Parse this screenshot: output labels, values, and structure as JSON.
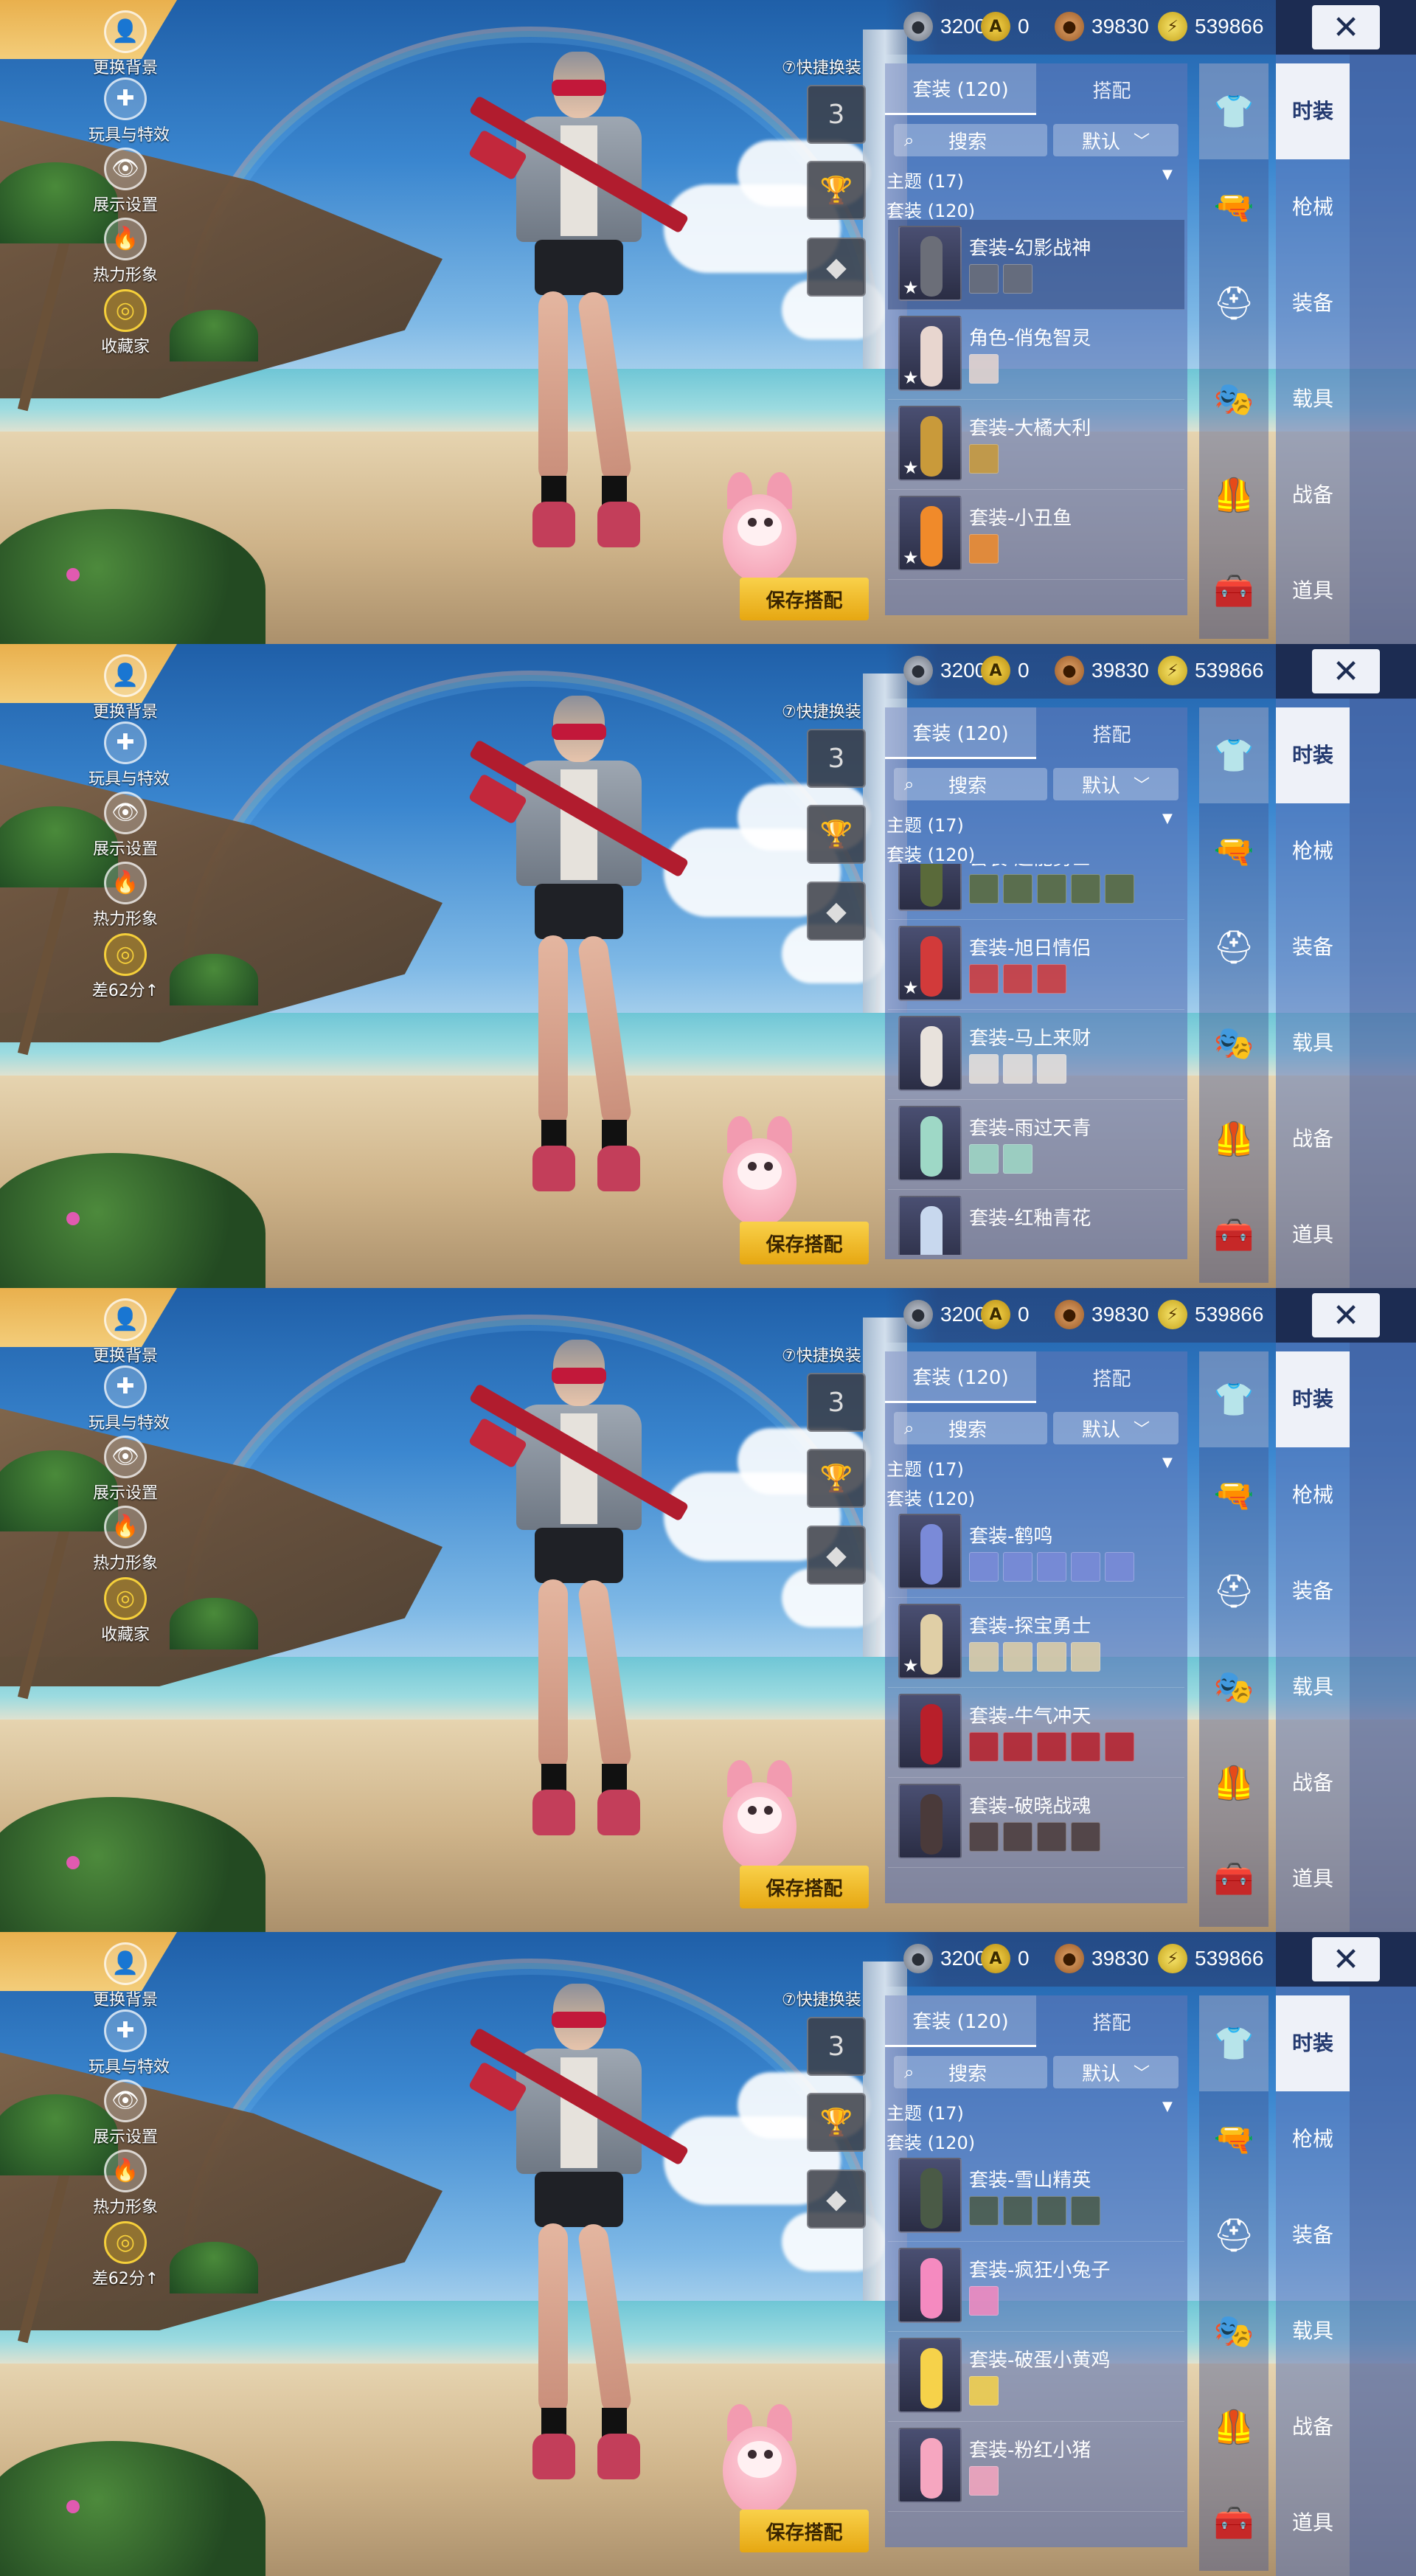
{
  "left_menu": [
    {
      "label": "更换背景",
      "icon": "person-icon",
      "glyph": "👤"
    },
    {
      "label": "玩具与特效",
      "icon": "puzzle-icon",
      "glyph": "✚"
    },
    {
      "label": "展示设置",
      "icon": "eye-icon",
      "glyph": "👁"
    },
    {
      "label": "热力形象",
      "icon": "flame-icon",
      "glyph": "🔥"
    }
  ],
  "collector_labels": [
    "收藏家",
    "差62分↑",
    "收藏家",
    "差62分↑"
  ],
  "currency": [
    {
      "icon": "silver-coin-icon",
      "glyph": "●",
      "value": "3200",
      "style": "grey"
    },
    {
      "icon": "gold-a-coin-icon",
      "glyph": "A",
      "value": "0",
      "style": "yellow"
    },
    {
      "icon": "bronze-coin-icon",
      "glyph": "●",
      "value": "39830",
      "style": "bronze"
    },
    {
      "icon": "lightning-coin-icon",
      "glyph": "⚡",
      "value": "539866",
      "style": "lightning"
    }
  ],
  "close_label": "✕",
  "quick_change": "⑦快捷换装",
  "quick_slots": [
    "3",
    "🏆",
    "◆"
  ],
  "save_label": "保存搭配",
  "tabs": [
    "套装 (120)",
    "搭配"
  ],
  "search_label": "搜索",
  "sort_label": "默认",
  "theme_label": "主题 (17)",
  "suits_label": "套装 (120)",
  "categories": [
    "时装",
    "枪械",
    "装备",
    "载具",
    "战备",
    "道具"
  ],
  "category_icons": [
    "clothing-icon",
    "gun-icon",
    "helmet-icon",
    "mask-icon",
    "vest-icon",
    "tools-icon"
  ],
  "category_glyphs": [
    "👕",
    "🔫",
    "⛑",
    "🎭",
    "🦺",
    "🧰"
  ],
  "frames": [
    {
      "items": [
        {
          "name": "套装-幻影战神",
          "parts": 2,
          "star": true,
          "color": "#6b6e78",
          "selected": true
        },
        {
          "name": "角色-俏兔智灵",
          "parts": 1,
          "star": true,
          "color": "#e8d6cf",
          "selected": false
        },
        {
          "name": "套装-大橘大利",
          "parts": 1,
          "star": true,
          "color": "#c99a3a",
          "selected": false
        },
        {
          "name": "套装-小丑鱼",
          "parts": 1,
          "star": true,
          "color": "#f08a2a",
          "selected": false
        }
      ]
    },
    {
      "items": [
        {
          "name": "套装-超能勇士",
          "parts": 5,
          "star": false,
          "color": "#5a6a3a",
          "selected": false
        },
        {
          "name": "套装-旭日情侣",
          "parts": 3,
          "star": true,
          "color": "#d23a3a",
          "selected": false
        },
        {
          "name": "套装-马上来财",
          "parts": 3,
          "star": false,
          "color": "#e8e2dc",
          "selected": false
        },
        {
          "name": "套装-雨过天青",
          "parts": 2,
          "star": false,
          "color": "#9ed8c6",
          "selected": false
        },
        {
          "name": "套装-红釉青花",
          "parts": 0,
          "star": false,
          "color": "#c8d8ee",
          "selected": false
        }
      ]
    },
    {
      "items": [
        {
          "name": "套装-鹤鸣",
          "parts": 5,
          "star": false,
          "color": "#7a8ad8",
          "selected": false
        },
        {
          "name": "套装-探宝勇士",
          "parts": 4,
          "star": true,
          "color": "#e0cfa6",
          "selected": false
        },
        {
          "name": "套装-牛气冲天",
          "parts": 5,
          "star": false,
          "color": "#b81f2a",
          "selected": false
        },
        {
          "name": "套装-破晓战魂",
          "parts": 4,
          "star": false,
          "color": "#4a3a3a",
          "selected": false
        }
      ]
    },
    {
      "items": [
        {
          "name": "套装-雪山精英",
          "parts": 4,
          "star": false,
          "color": "#4a5a46",
          "selected": false
        },
        {
          "name": "套装-疯狂小兔子",
          "parts": 1,
          "star": false,
          "color": "#f58ac0",
          "selected": false
        },
        {
          "name": "套装-破蛋小黄鸡",
          "parts": 1,
          "star": false,
          "color": "#f6d24a",
          "selected": false
        },
        {
          "name": "套装-粉红小猪",
          "parts": 1,
          "star": false,
          "color": "#f6a6c0",
          "selected": false
        }
      ]
    }
  ]
}
